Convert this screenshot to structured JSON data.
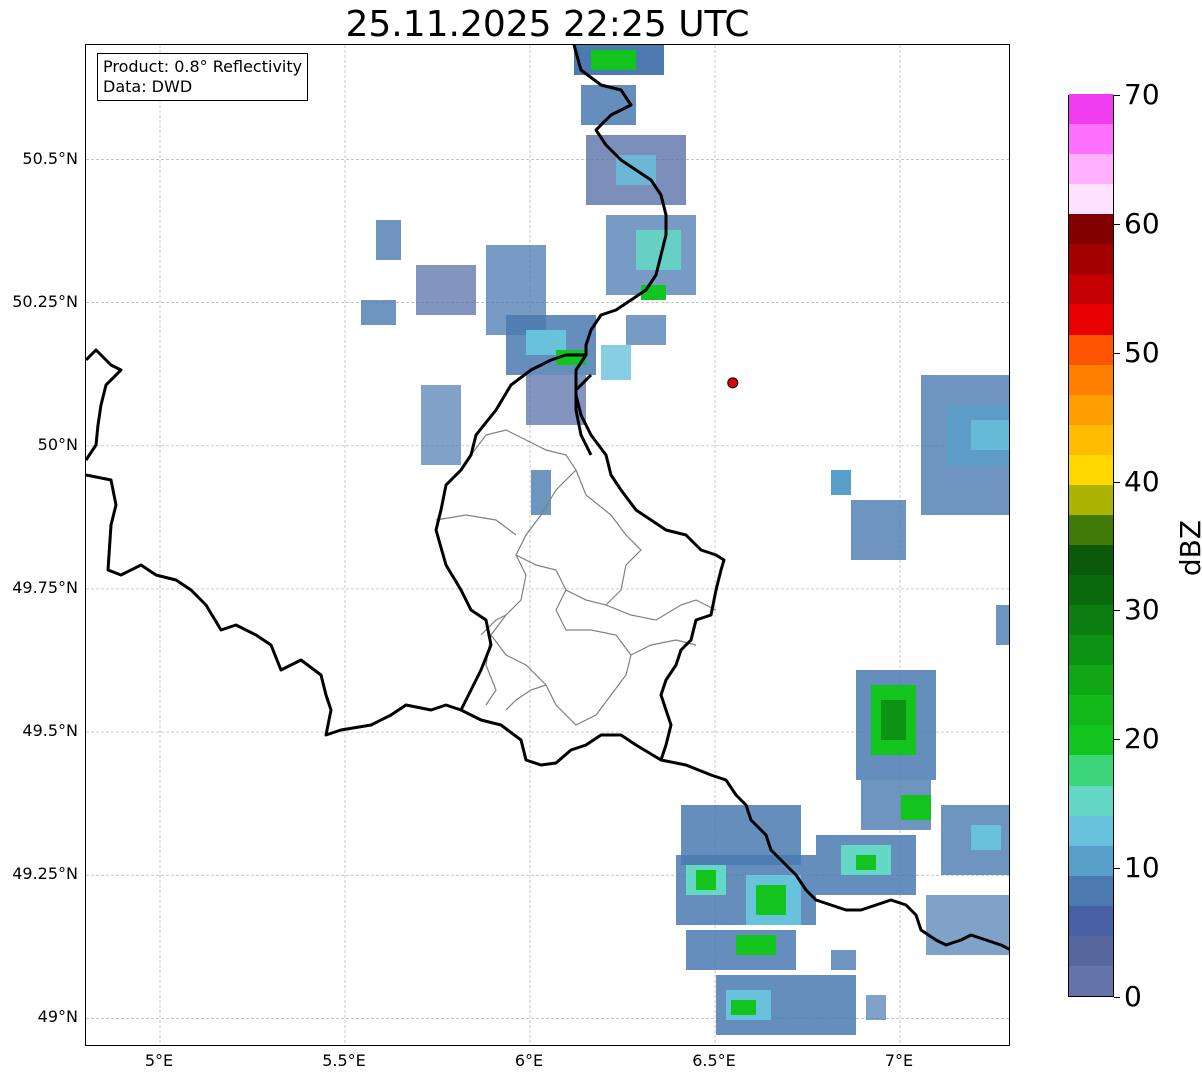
{
  "title": "25.11.2025 22:25 UTC",
  "info_box": {
    "product": "Product: 0.8° Reflectivity",
    "data": "Data: DWD"
  },
  "map": {
    "lon_range": [
      4.8,
      7.3
    ],
    "lat_range": [
      48.95,
      50.7
    ],
    "lat_ticks": [
      {
        "value": 50.5,
        "label": "50.5°N"
      },
      {
        "value": 50.25,
        "label": "50.25°N"
      },
      {
        "value": 50.0,
        "label": "50°N"
      },
      {
        "value": 49.75,
        "label": "49.75°N"
      },
      {
        "value": 49.5,
        "label": "49.5°N"
      },
      {
        "value": 49.25,
        "label": "49.25°N"
      },
      {
        "value": 49.0,
        "label": "49°N"
      }
    ],
    "lon_ticks": [
      {
        "value": 5.0,
        "label": "5°E"
      },
      {
        "value": 5.5,
        "label": "5.5°E"
      },
      {
        "value": 6.0,
        "label": "6°E"
      },
      {
        "value": 6.5,
        "label": "6.5°E"
      },
      {
        "value": 7.0,
        "label": "7°E"
      }
    ],
    "gridlines": true,
    "radar_site": {
      "lon": 6.548,
      "lat": 50.11,
      "color": "#e00000"
    },
    "country_border_color": "#000000",
    "admin_border_color": "#808080"
  },
  "colorbar": {
    "unit": "dBZ",
    "min": 0,
    "max": 70,
    "tick_labels": [
      "0",
      "10",
      "20",
      "30",
      "40",
      "50",
      "60",
      "70"
    ],
    "colors": [
      "#6574a8",
      "#56679e",
      "#4860a4",
      "#4a7ab0",
      "#579ec8",
      "#68c2dc",
      "#64d8c4",
      "#3dd67a",
      "#14c41e",
      "#12b81a",
      "#10a614",
      "#0e9214",
      "#0c7e12",
      "#0a6a0e",
      "#0a5a0a",
      "#427a08",
      "#aab400",
      "#ffd800",
      "#ffbc00",
      "#ff9e00",
      "#ff8000",
      "#ff5400",
      "#e60000",
      "#c40000",
      "#a40000",
      "#820000",
      "#ffe0ff",
      "#ffb0ff",
      "#ff70ff",
      "#ee3cee"
    ]
  }
}
